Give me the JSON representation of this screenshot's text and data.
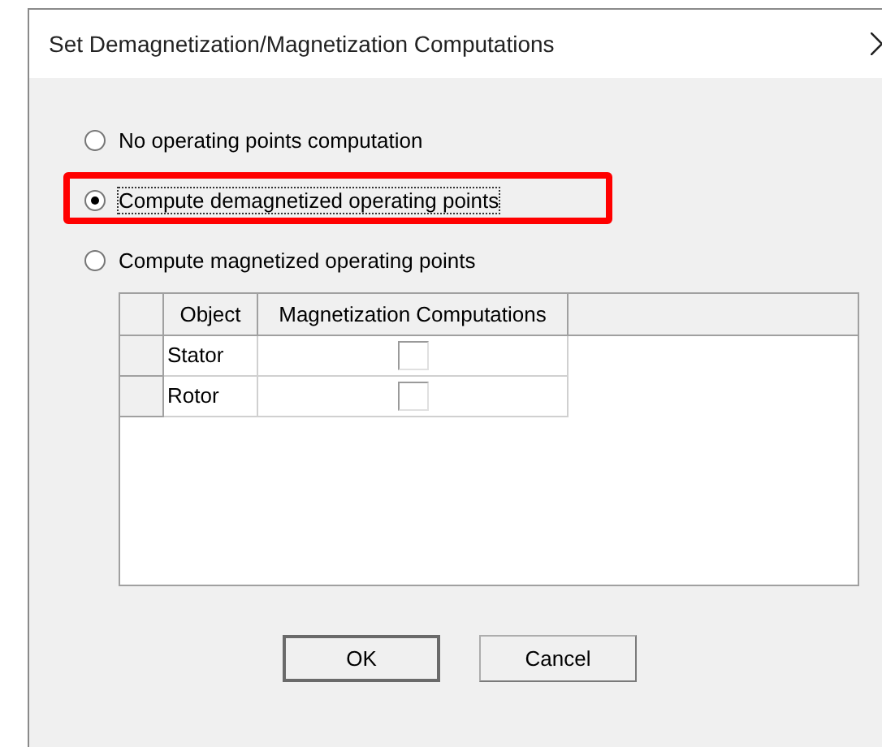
{
  "window": {
    "title": "Set Demagnetization/Magnetization Computations"
  },
  "options": [
    {
      "label": "No operating points computation",
      "selected": false,
      "highlighted": false
    },
    {
      "label": "Compute demagnetized operating points",
      "selected": true,
      "highlighted": true
    },
    {
      "label": "Compute magnetized operating points",
      "selected": false,
      "highlighted": false
    }
  ],
  "table": {
    "columns": [
      "Object",
      "Magnetization Computations"
    ],
    "rows": [
      {
        "object": "Stator",
        "checked": false
      },
      {
        "object": "Rotor",
        "checked": false
      }
    ]
  },
  "buttons": [
    "OK",
    "Cancel"
  ]
}
